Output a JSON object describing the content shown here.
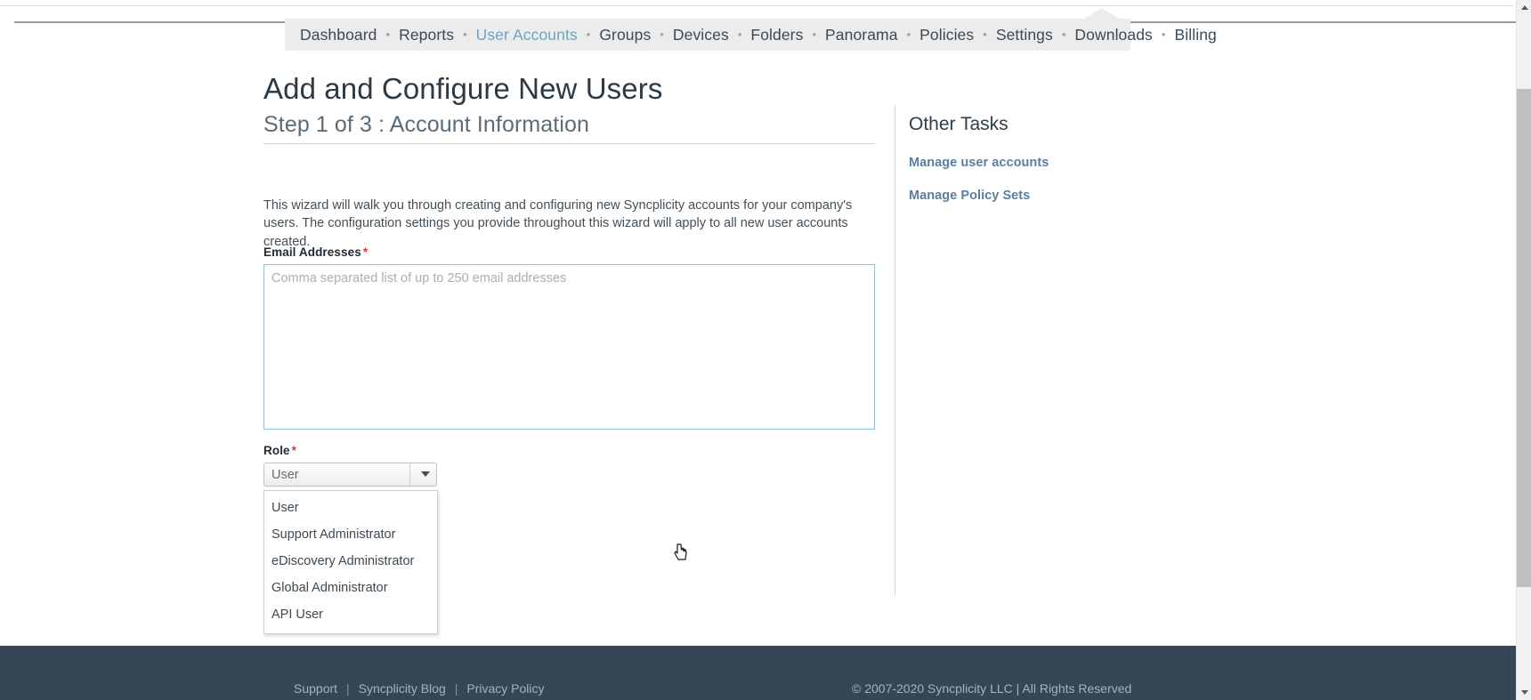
{
  "nav": {
    "items": [
      {
        "label": "Dashboard",
        "active": false
      },
      {
        "label": "Reports",
        "active": false
      },
      {
        "label": "User Accounts",
        "active": true
      },
      {
        "label": "Groups",
        "active": false
      },
      {
        "label": "Devices",
        "active": false
      },
      {
        "label": "Folders",
        "active": false
      },
      {
        "label": "Panorama",
        "active": false
      },
      {
        "label": "Policies",
        "active": false
      },
      {
        "label": "Settings",
        "active": false
      },
      {
        "label": "Downloads",
        "active": false
      },
      {
        "label": "Billing",
        "active": false
      }
    ],
    "separator": "•",
    "active_color": "#6aa5c4",
    "background": "#ececec"
  },
  "main": {
    "title": "Add and Configure New Users",
    "subtitle": "Step 1 of 3 : Account Information",
    "intro": "This wizard will walk you through creating and configuring new Syncplicity accounts for your company's users. The configuration settings you provide throughout this wizard will apply to all new user accounts created.",
    "email_field": {
      "label": "Email Addresses",
      "required_marker": "*",
      "placeholder": "Comma separated list of up to 250 email addresses",
      "value": "",
      "border_color": "#8fc2de"
    },
    "role_field": {
      "label": "Role",
      "required_marker": "*",
      "selected": "User",
      "expanded": true,
      "options": [
        "User",
        "Support Administrator",
        "eDiscovery Administrator",
        "Global Administrator",
        "API User"
      ]
    }
  },
  "other_tasks": {
    "title": "Other Tasks",
    "links": [
      "Manage user accounts",
      "Manage Policy Sets"
    ],
    "link_color": "#5a7fa0"
  },
  "footer": {
    "links": [
      "Support",
      "Syncplicity Blog",
      "Privacy Policy"
    ],
    "separator": "|",
    "copyright": "© 2007-2020 Syncplicity LLC   |   All Rights Reserved",
    "background": "#374655"
  },
  "scrollbar": {
    "up_arrow": "scroll-up-arrow",
    "down_arrow": "scroll-down-arrow"
  }
}
